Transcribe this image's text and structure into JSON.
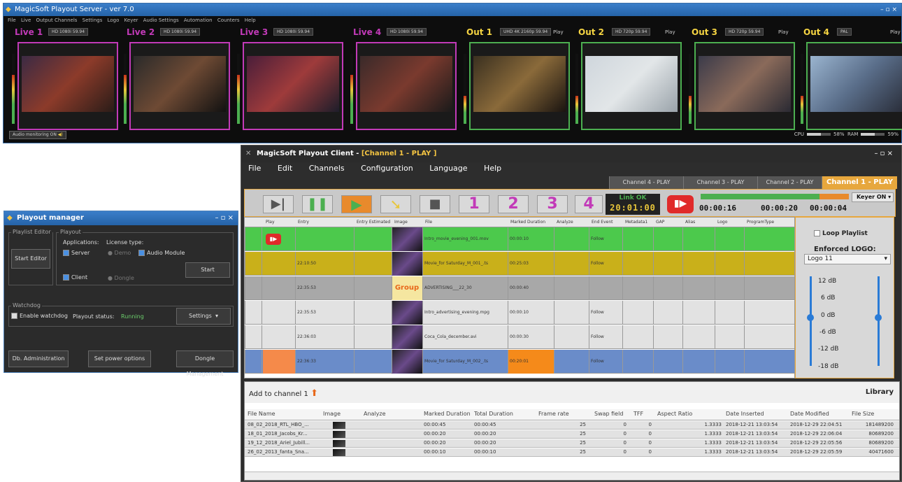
{
  "server": {
    "title": "MagicSoft Playout Server - ver 7.0",
    "menu": [
      "File",
      "Live",
      "Output Channels",
      "Settings",
      "Logo",
      "Keyer",
      "Audio Settings",
      "Automation",
      "Counters",
      "Help"
    ],
    "window_controls": "– ▫ ×",
    "channels": [
      {
        "label": "Live 1",
        "format": "HD 1080i 59.94",
        "type": "live",
        "play": ""
      },
      {
        "label": "Live 2",
        "format": "HD 1080i 59.94",
        "type": "live",
        "play": ""
      },
      {
        "label": "Live 3",
        "format": "HD 1080i 59.94",
        "type": "live",
        "play": ""
      },
      {
        "label": "Live 4",
        "format": "HD 1080i 59.94",
        "type": "live",
        "play": ""
      },
      {
        "label": "Out 1",
        "format": "UHD 4K 2160p 59.94",
        "type": "out",
        "play": "Play"
      },
      {
        "label": "Out 2",
        "format": "HD 720p 59.94",
        "type": "out",
        "play": "Play"
      },
      {
        "label": "Out 3",
        "format": "HD 720p 59.94",
        "type": "out",
        "play": "Play"
      },
      {
        "label": "Out 4",
        "format": "PAL",
        "type": "out",
        "play": "Play"
      }
    ],
    "audio_monitoring": "Audio monitoring ON",
    "cpu_label": "CPU",
    "cpu_value": "58%",
    "cpu_fraction": 0.58,
    "ram_label": "RAM",
    "ram_value": "59%",
    "ram_fraction": 0.59,
    "colors": {
      "live": "#c23ab8",
      "out": "#4caf50",
      "live_text": "#c23ab8",
      "out_text": "#f5d442"
    }
  },
  "manager": {
    "title": "Playout manager",
    "window_controls": "– ▫ ×",
    "playlist_editor_legend": "Playlist Editor",
    "start_editor": "Start Editor",
    "playout_legend": "Playout",
    "applications_label": "Applications:",
    "license_label": "License type:",
    "server_check": "Server",
    "client_check": "Client",
    "demo_radio": "Demo",
    "dongle_radio": "Dongle",
    "audio_module_check": "Audio Module",
    "start": "Start",
    "watchdog_legend": "Watchdog",
    "enable_watchdog": "Enable watchdog",
    "status_label": "Playout status:",
    "status_value": "Running",
    "settings": "Settings",
    "db_admin": "Db. Administration",
    "power_options": "Set power options",
    "dongle_mgmt": "Dongle Management"
  },
  "client": {
    "title_prefix": "MagicSoft Playout Client - ",
    "title_channel": "[Channel 1 - PLAY ]",
    "window_controls": "–    ▫    ×",
    "menu": [
      "File",
      "Edit",
      "Channels",
      "Configuration",
      "Language",
      "Help"
    ],
    "tabs": [
      "Channel 4 - PLAY",
      "Channel 3 - PLAY",
      "Channel 2 - PLAY",
      "Channel 1 - PLAY"
    ],
    "toolbar": {
      "btn1": "1",
      "btn2": "2",
      "btn3": "3",
      "btn4": "4",
      "link_status": "Link OK",
      "clock": "20:01:00",
      "elapsed": "00:00:16",
      "total": "00:00:20",
      "remaining": "00:00:04",
      "keyer": "Keyer ON",
      "progress_fraction": 0.8
    },
    "grid_headers": [
      "Play",
      "Entry",
      "Entry Estimated",
      "Image",
      "File",
      "Marked Duration",
      "Analyze",
      "End Event",
      "Metadata1",
      "GAP",
      "Alias",
      "Logo",
      "ProgramType"
    ],
    "rows": [
      {
        "entry": "",
        "file": "Intro_movie_evening_001.mov",
        "marked": "00:00:10",
        "end": "Follow",
        "color": "#4cc94c",
        "play": "icon"
      },
      {
        "entry": "22:10:50",
        "file": "Movie_for Saturday_M_001_.ts",
        "marked": "00:25:03",
        "end": "Follow",
        "color": "#c9b01a",
        "play": ""
      },
      {
        "entry": "22:35:53",
        "file": "ADVERTISING___22_30",
        "marked": "00:00:40",
        "end": "",
        "color": "#a8a8a8",
        "play": "",
        "image": "Group"
      },
      {
        "entry": "22:35:53",
        "file": "Intro_advertising_evening.mpg",
        "marked": "00:00:10",
        "end": "Follow",
        "color": "#e2e2e2",
        "play": ""
      },
      {
        "entry": "22:36:03",
        "file": "Coca_Cola_december.avi",
        "marked": "00:00:30",
        "end": "Follow",
        "color": "#e2e2e2",
        "play": ""
      },
      {
        "entry": "22:36:33",
        "file": "Movie_for Saturday_M_002_.ts",
        "marked": "00:20:01",
        "end": "Follow",
        "color": "#6a8cc9",
        "play": ""
      }
    ],
    "side": {
      "loop_playlist": "Loop Playlist",
      "enforced_logo": "Enforced LOGO:",
      "logo_value": "Logo 11",
      "db_marks": [
        "12 dB",
        "6 dB",
        "0 dB",
        "-6 dB",
        "-12 dB",
        "-18 dB"
      ]
    },
    "library": {
      "add_to": "Add to channel 1",
      "title": "Library",
      "headers": [
        "File Name",
        "Image",
        "Analyze",
        "Marked Duration",
        "Total Duration",
        "Frame rate",
        "Swap field",
        "TFF",
        "Aspect Ratio",
        "Date Inserted",
        "Date Modified",
        "File Size"
      ],
      "rows": [
        [
          "08_02_2018_RTL_HBO_...",
          "",
          "",
          "00:00:45",
          "00:00:45",
          "25",
          "0",
          "0",
          "1.3333",
          "2018-12-21 13:03:54",
          "2018-12-29 22:04:51",
          "181489200"
        ],
        [
          "18_01_2018_Jacobs_Kr...",
          "",
          "",
          "00:00:20",
          "00:00:20",
          "25",
          "0",
          "0",
          "1.3333",
          "2018-12-21 13:03:54",
          "2018-12-29 22:06:04",
          "80689200"
        ],
        [
          "19_12_2018_Ariel_Jubill...",
          "",
          "",
          "00:00:20",
          "00:00:20",
          "25",
          "0",
          "0",
          "1.3333",
          "2018-12-21 13:03:54",
          "2018-12-29 22:05:56",
          "80689200"
        ],
        [
          "26_02_2013_fanta_Sna...",
          "",
          "",
          "00:00:10",
          "00:00:10",
          "25",
          "0",
          "0",
          "1.3333",
          "2018-12-21 13:03:54",
          "2018-12-29 22:05:59",
          "40471600"
        ]
      ]
    }
  }
}
